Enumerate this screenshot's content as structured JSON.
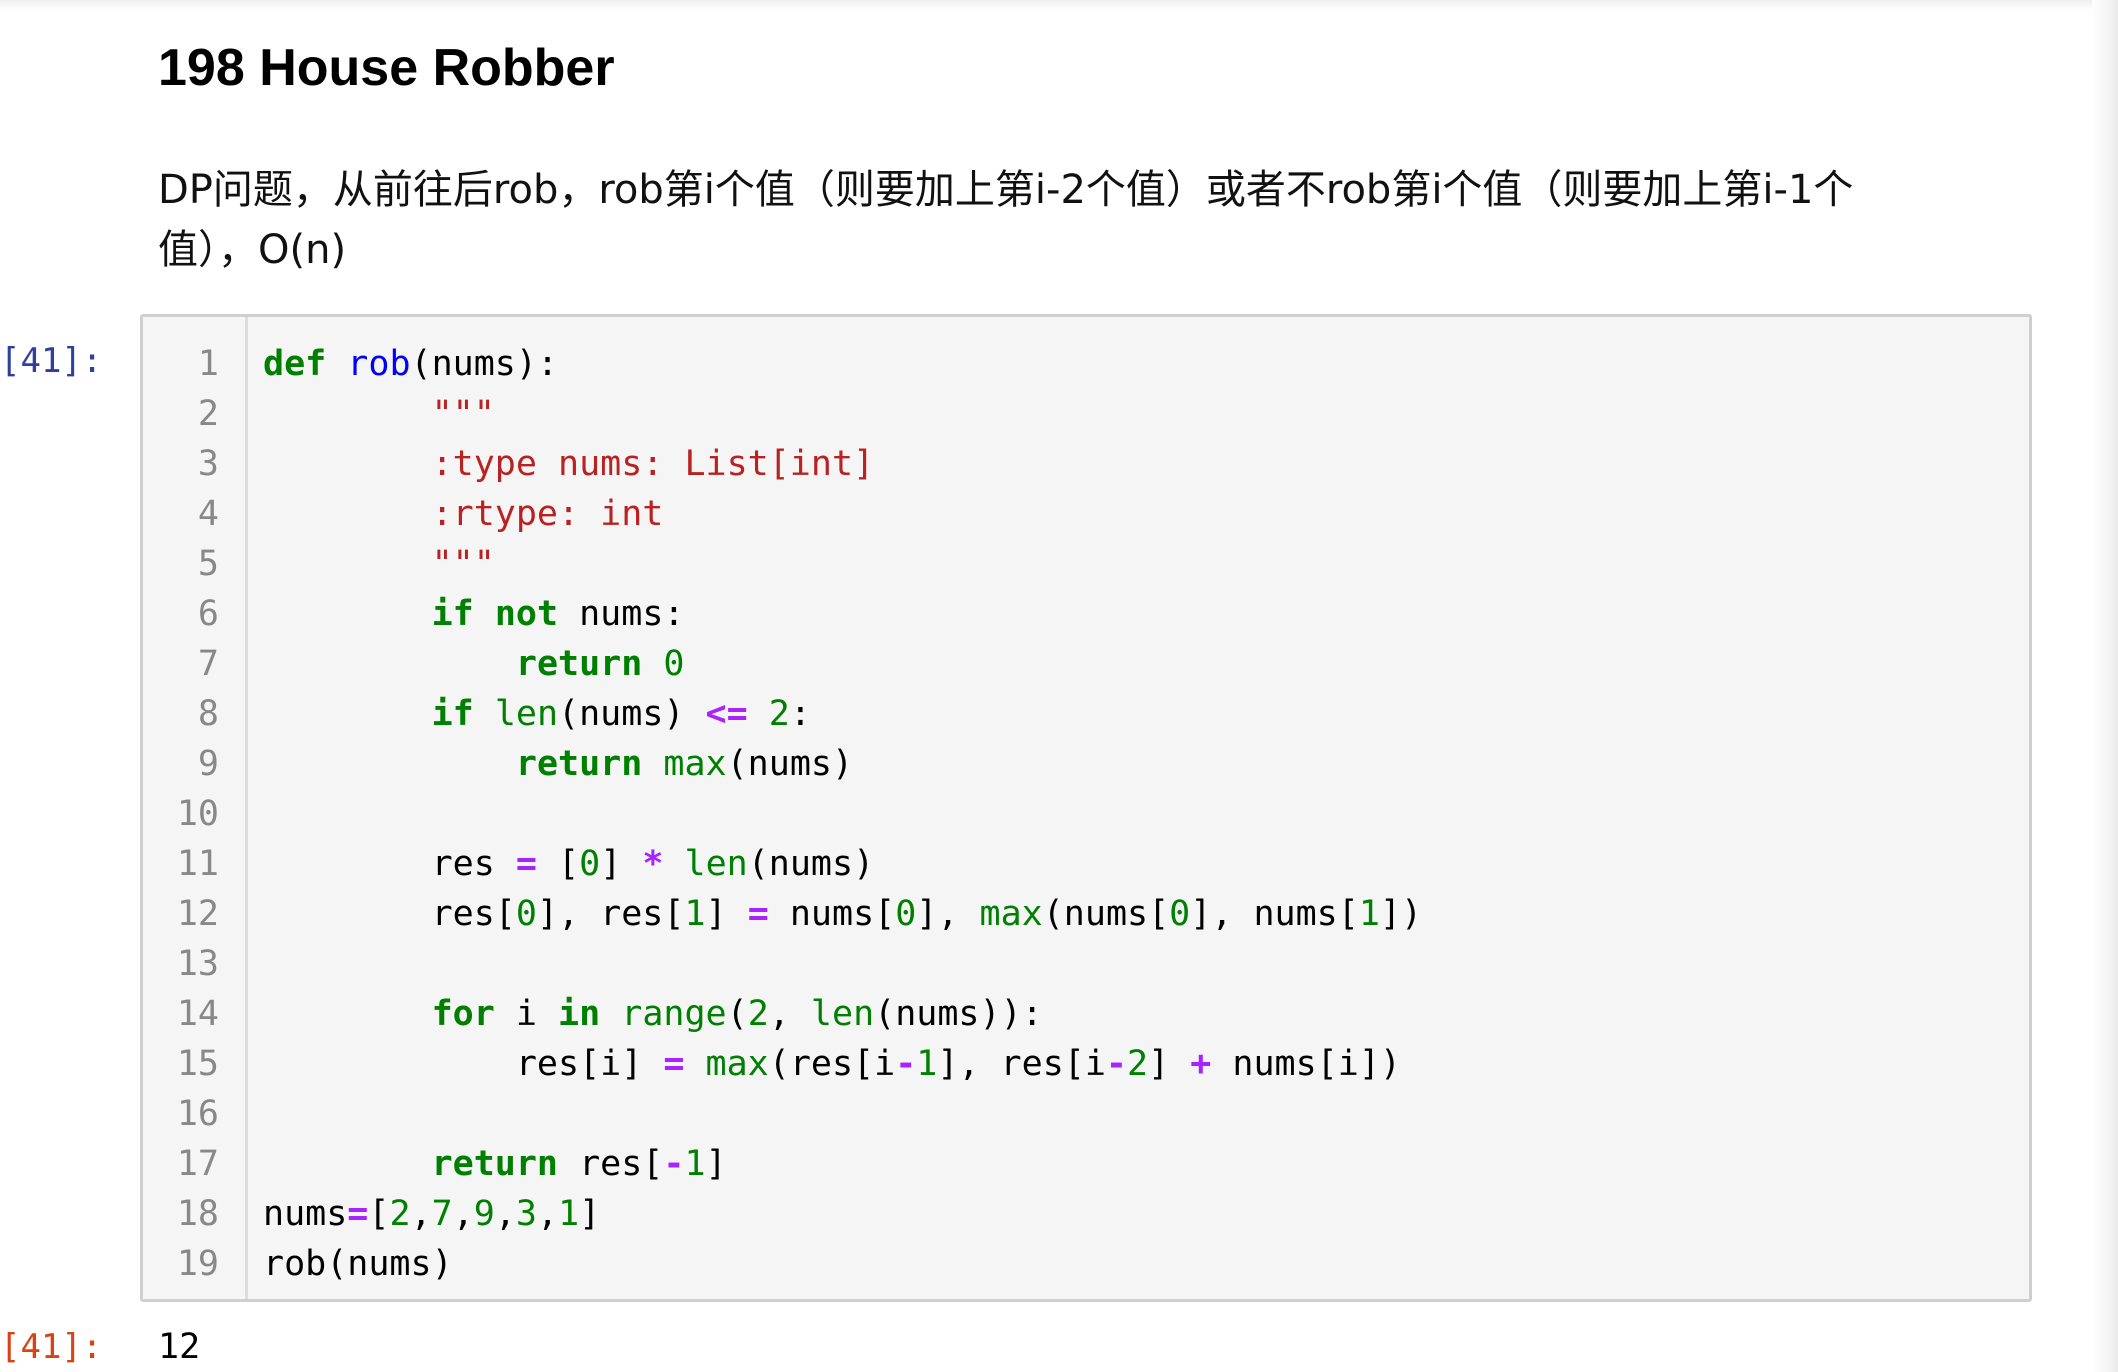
{
  "markdown": {
    "title": "198 House Robber",
    "description": "DP问题，从前往后rob，rob第i个值（则要加上第i-2个值）或者不rob第i个值（则要加上第i-1个值），O(n)"
  },
  "code_cell": {
    "in_prompt": "[41]:",
    "line_numbers": [
      "1",
      "2",
      "3",
      "4",
      "5",
      "6",
      "7",
      "8",
      "9",
      "10",
      "11",
      "12",
      "13",
      "14",
      "15",
      "16",
      "17",
      "18",
      "19"
    ],
    "lines": [
      [
        {
          "t": "def",
          "c": "kw"
        },
        {
          "t": " "
        },
        {
          "t": "rob",
          "c": "def"
        },
        {
          "t": "(nums):"
        }
      ],
      [
        {
          "t": "        "
        },
        {
          "t": "\"\"\"",
          "c": "st"
        }
      ],
      [
        {
          "t": "        "
        },
        {
          "t": ":type nums: List[int]",
          "c": "st"
        }
      ],
      [
        {
          "t": "        "
        },
        {
          "t": ":rtype: int",
          "c": "st"
        }
      ],
      [
        {
          "t": "        "
        },
        {
          "t": "\"\"\"",
          "c": "st"
        }
      ],
      [
        {
          "t": "        "
        },
        {
          "t": "if",
          "c": "kw"
        },
        {
          "t": " "
        },
        {
          "t": "not",
          "c": "kw"
        },
        {
          "t": " nums:"
        }
      ],
      [
        {
          "t": "            "
        },
        {
          "t": "return",
          "c": "kw"
        },
        {
          "t": " "
        },
        {
          "t": "0",
          "c": "num"
        }
      ],
      [
        {
          "t": "        "
        },
        {
          "t": "if",
          "c": "kw"
        },
        {
          "t": " "
        },
        {
          "t": "len",
          "c": "bi"
        },
        {
          "t": "(nums) "
        },
        {
          "t": "<=",
          "c": "op"
        },
        {
          "t": " "
        },
        {
          "t": "2",
          "c": "num"
        },
        {
          "t": ":"
        }
      ],
      [
        {
          "t": "            "
        },
        {
          "t": "return",
          "c": "kw"
        },
        {
          "t": " "
        },
        {
          "t": "max",
          "c": "bi"
        },
        {
          "t": "(nums)"
        }
      ],
      [
        {
          "t": ""
        }
      ],
      [
        {
          "t": "        res "
        },
        {
          "t": "=",
          "c": "op"
        },
        {
          "t": " ["
        },
        {
          "t": "0",
          "c": "num"
        },
        {
          "t": "] "
        },
        {
          "t": "*",
          "c": "op"
        },
        {
          "t": " "
        },
        {
          "t": "len",
          "c": "bi"
        },
        {
          "t": "(nums)"
        }
      ],
      [
        {
          "t": "        res["
        },
        {
          "t": "0",
          "c": "num"
        },
        {
          "t": "], res["
        },
        {
          "t": "1",
          "c": "num"
        },
        {
          "t": "] "
        },
        {
          "t": "=",
          "c": "op"
        },
        {
          "t": " nums["
        },
        {
          "t": "0",
          "c": "num"
        },
        {
          "t": "], "
        },
        {
          "t": "max",
          "c": "bi"
        },
        {
          "t": "(nums["
        },
        {
          "t": "0",
          "c": "num"
        },
        {
          "t": "], nums["
        },
        {
          "t": "1",
          "c": "num"
        },
        {
          "t": "])"
        }
      ],
      [
        {
          "t": ""
        }
      ],
      [
        {
          "t": "        "
        },
        {
          "t": "for",
          "c": "kw"
        },
        {
          "t": " i "
        },
        {
          "t": "in",
          "c": "kw"
        },
        {
          "t": " "
        },
        {
          "t": "range",
          "c": "bi"
        },
        {
          "t": "("
        },
        {
          "t": "2",
          "c": "num"
        },
        {
          "t": ", "
        },
        {
          "t": "len",
          "c": "bi"
        },
        {
          "t": "(nums)):"
        }
      ],
      [
        {
          "t": "            res[i] "
        },
        {
          "t": "=",
          "c": "op"
        },
        {
          "t": " "
        },
        {
          "t": "max",
          "c": "bi"
        },
        {
          "t": "(res[i"
        },
        {
          "t": "-",
          "c": "op"
        },
        {
          "t": "1",
          "c": "num"
        },
        {
          "t": "], res[i"
        },
        {
          "t": "-",
          "c": "op"
        },
        {
          "t": "2",
          "c": "num"
        },
        {
          "t": "] "
        },
        {
          "t": "+",
          "c": "op"
        },
        {
          "t": " nums[i])"
        }
      ],
      [
        {
          "t": ""
        }
      ],
      [
        {
          "t": "        "
        },
        {
          "t": "return",
          "c": "kw"
        },
        {
          "t": " res["
        },
        {
          "t": "-",
          "c": "op"
        },
        {
          "t": "1",
          "c": "num"
        },
        {
          "t": "]"
        }
      ],
      [
        {
          "t": "nums"
        },
        {
          "t": "=",
          "c": "op"
        },
        {
          "t": "["
        },
        {
          "t": "2",
          "c": "num"
        },
        {
          "t": ","
        },
        {
          "t": "7",
          "c": "num"
        },
        {
          "t": ","
        },
        {
          "t": "9",
          "c": "num"
        },
        {
          "t": ","
        },
        {
          "t": "3",
          "c": "num"
        },
        {
          "t": ","
        },
        {
          "t": "1",
          "c": "num"
        },
        {
          "t": "]"
        }
      ],
      [
        {
          "t": "rob(nums)"
        }
      ]
    ]
  },
  "output_cell": {
    "out_prompt": "[41]:",
    "value": "12"
  },
  "colors": {
    "in_prompt": "#303f9f",
    "out_prompt": "#d84315",
    "keyword": "#008000",
    "function_name": "#0000ff",
    "string": "#ba2121",
    "operator": "#aa22ff",
    "code_background": "#f5f5f5"
  }
}
